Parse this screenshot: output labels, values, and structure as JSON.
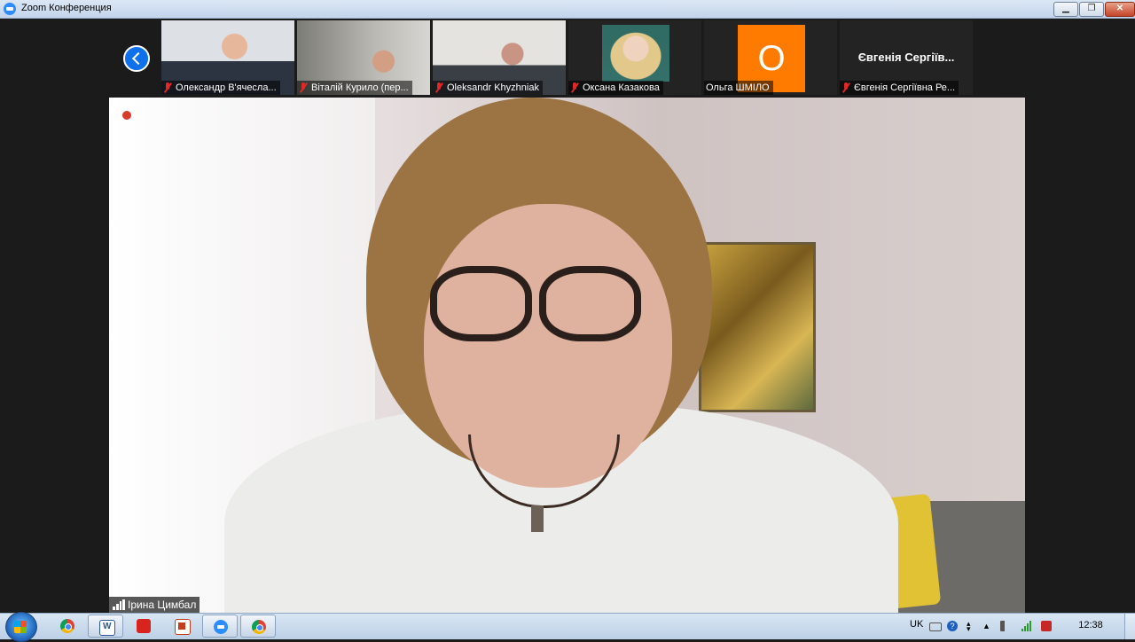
{
  "window": {
    "title": "Zoom Конференция",
    "controls": {
      "minimize": "▁",
      "maximize": "❐",
      "close": "✕"
    }
  },
  "gallery_strip": {
    "prev_icon": "chevron-left-icon",
    "participants": [
      {
        "name": "Олександр В'ячесла...",
        "muted": true
      },
      {
        "name": "Віталій Курило (пер...",
        "muted": true
      },
      {
        "name": "Oleksandr Khyzhniak",
        "muted": true
      },
      {
        "name": "Оксана Казакова",
        "muted": true
      },
      {
        "name": "Ольга ШМІЛО",
        "muted": false,
        "avatar_letter": "О",
        "avatar_color": "#ff7b00"
      },
      {
        "name": "Євгенія Сергіївна Ре...",
        "muted": true,
        "display_name": "Євгенія Сергіїв..."
      }
    ]
  },
  "active_speaker": {
    "name": "Ірина Цимбал",
    "recording_indicator_color": "#d93b2b"
  },
  "taskbar": {
    "apps": [
      "start",
      "chrome",
      "word",
      "acrobat",
      "presentation",
      "zoom",
      "chrome"
    ],
    "tray": {
      "language": "UK",
      "time": "12:38"
    }
  }
}
